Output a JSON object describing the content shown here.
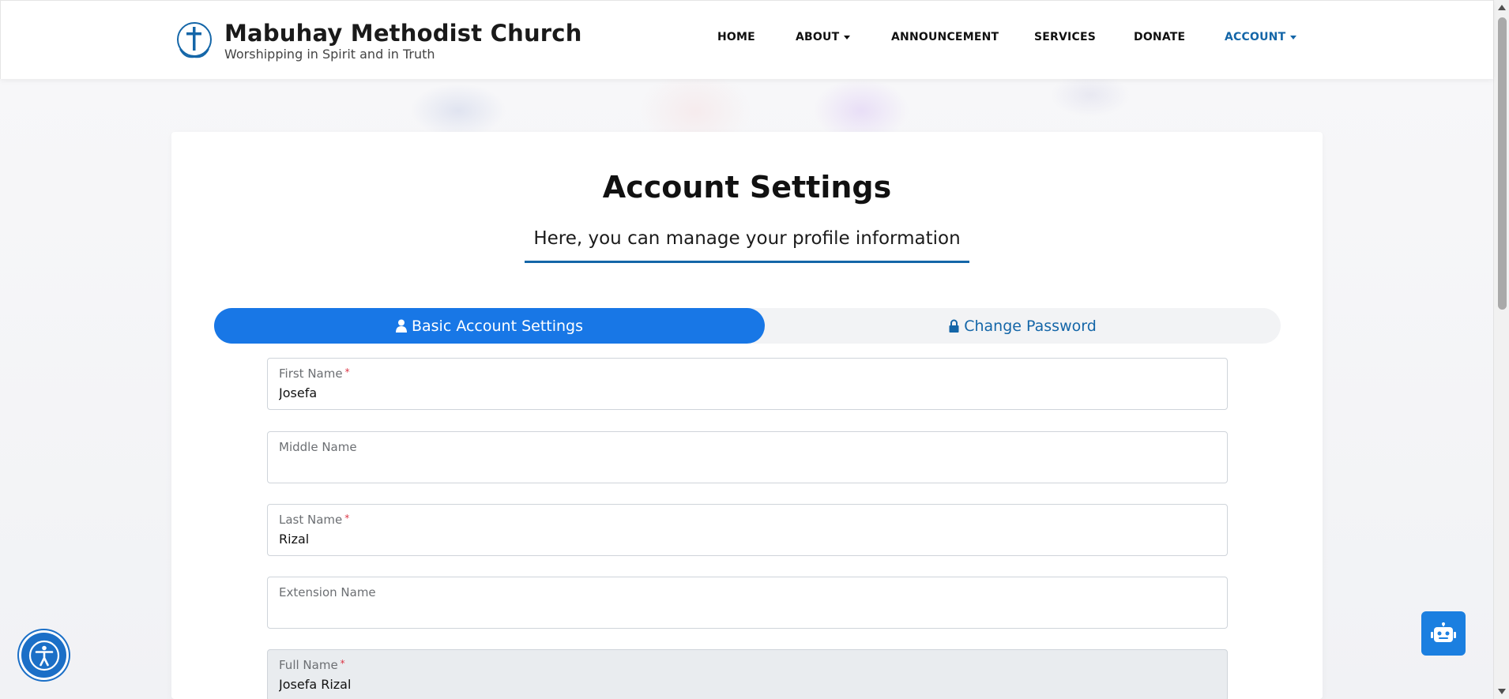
{
  "brand": {
    "title": "Mabuhay Methodist Church",
    "subtitle": "Worshipping in Spirit and in Truth"
  },
  "nav": {
    "home": "HOME",
    "about": "ABOUT",
    "announcement": "ANNOUNCEMENT",
    "services": "SERVICES",
    "donate": "DONATE",
    "account": "ACCOUNT"
  },
  "page": {
    "title": "Account Settings",
    "subtitle": "Here, you can manage your profile information"
  },
  "tabs": {
    "basic": "Basic Account Settings",
    "password": "Change Password"
  },
  "form": {
    "first_name": {
      "label": "First Name",
      "required": "*",
      "value": "Josefa"
    },
    "middle_name": {
      "label": "Middle Name",
      "value": ""
    },
    "last_name": {
      "label": "Last Name",
      "required": "*",
      "value": "Rizal"
    },
    "extension_name": {
      "label": "Extension Name",
      "value": ""
    },
    "full_name": {
      "label": "Full Name",
      "required": "*",
      "value": "Josefa Rizal"
    }
  },
  "colors": {
    "accent": "#1877e6",
    "brand_blue": "#1466a8",
    "required": "#dc3545"
  },
  "icons": {
    "logo": "cross-circle-logo",
    "basic_tab": "user-icon",
    "password_tab": "lock-icon",
    "accessibility": "accessibility-icon",
    "chatbot": "robot-icon"
  }
}
